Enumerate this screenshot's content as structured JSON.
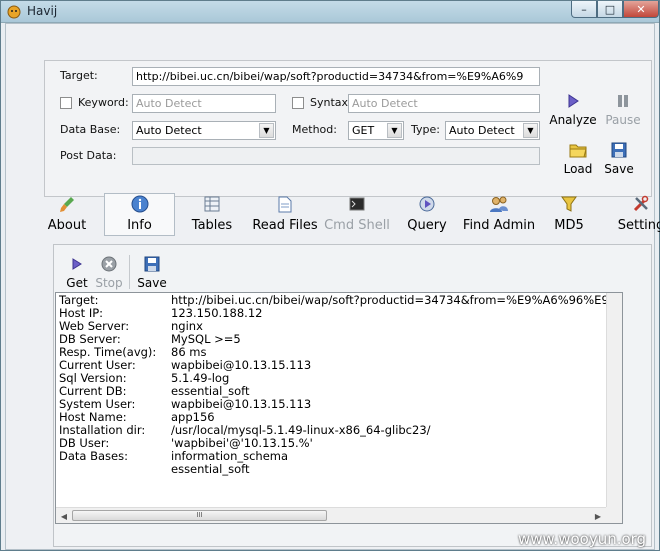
{
  "app": {
    "title": "Havij"
  },
  "window": {
    "minimize": "–",
    "maximize": "□",
    "close": "✕"
  },
  "form": {
    "target_label": "Target:",
    "target_value": "http://bibei.uc.cn/bibei/wap/soft?productid=34734&from=%E9%A6%9",
    "keyword_label": "Keyword:",
    "keyword_placeholder": "Auto Detect",
    "syntax_label": "Syntax:",
    "syntax_placeholder": "Auto Detect",
    "database_label": "Data Base:",
    "database_value": "Auto Detect",
    "method_label": "Method:",
    "method_value": "GET",
    "type_label": "Type:",
    "type_value": "Auto Detect",
    "postdata_label": "Post Data:"
  },
  "actions": {
    "analyze": "Analyze",
    "pause": "Pause",
    "load": "Load",
    "save": "Save"
  },
  "tabs": [
    {
      "label": "About",
      "icon": "brush-icon"
    },
    {
      "label": "Info",
      "icon": "info-icon",
      "active": true
    },
    {
      "label": "Tables",
      "icon": "table-icon"
    },
    {
      "label": "Read Files",
      "icon": "file-icon"
    },
    {
      "label": "Cmd Shell",
      "icon": "terminal-icon",
      "disabled": true
    },
    {
      "label": "Query",
      "icon": "query-icon"
    },
    {
      "label": "Find Admin",
      "icon": "users-icon"
    },
    {
      "label": "MD5",
      "icon": "funnel-icon"
    },
    {
      "label": "Setting",
      "icon": "tools-icon"
    }
  ],
  "info_toolbar": {
    "get": "Get",
    "stop": "Stop",
    "save": "Save"
  },
  "info_rows": [
    {
      "key": "Target:",
      "value": "http://bibei.uc.cn/bibei/wap/soft?productid=34734&from=%E9%A6%96%E9"
    },
    {
      "key": "Host IP:",
      "value": "123.150.188.12"
    },
    {
      "key": "Web Server:",
      "value": "nginx"
    },
    {
      "key": "DB Server:",
      "value": "MySQL >=5"
    },
    {
      "key": "Resp. Time(avg):",
      "value": "86 ms"
    },
    {
      "key": "Current User:",
      "value": "wapbibei@10.13.15.113"
    },
    {
      "key": "Sql Version:",
      "value": "5.1.49-log"
    },
    {
      "key": "Current DB:",
      "value": "essential_soft"
    },
    {
      "key": "System User:",
      "value": "wapbibei@10.13.15.113"
    },
    {
      "key": "Host Name:",
      "value": "app156"
    },
    {
      "key": "Installation dir:",
      "value": "/usr/local/mysql-5.1.49-linux-x86_64-glibc23/"
    },
    {
      "key": "DB User:",
      "value": "'wapbibei'@'10.13.15.%'"
    },
    {
      "key": "Data Bases:",
      "value": "information_schema"
    },
    {
      "key": "",
      "value": "essential_soft"
    }
  ],
  "scroll": {
    "thumb_grip": "III"
  },
  "watermark": "www.wooyun.org",
  "colors": {
    "accent": "#3a6ea5",
    "close_button": "#c2473a"
  }
}
